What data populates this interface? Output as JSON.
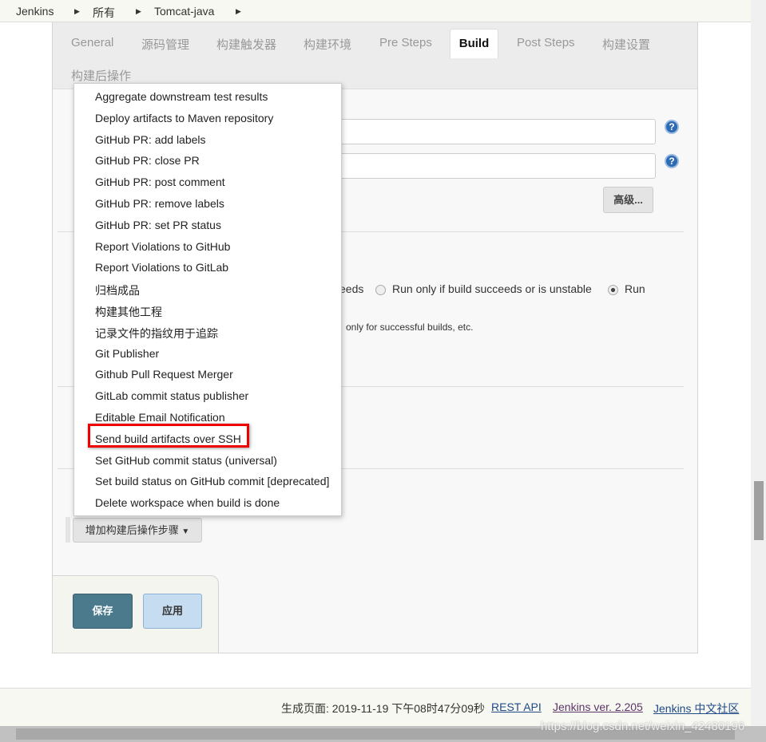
{
  "breadcrumb": [
    "Jenkins",
    "所有",
    "Tomcat-java"
  ],
  "tabs": [
    "General",
    "源码管理",
    "构建触发器",
    "构建环境",
    "Pre Steps",
    "Build",
    "Post Steps",
    "构建设置",
    "构建后操作"
  ],
  "active_tab": "Build",
  "advanced_button": "高级...",
  "radio_fragment": "eeds",
  "radio_option_unstable": "Run only if build succeeds or is unstable",
  "radio_option_run": "Run",
  "help_fragment": "only for successful builds, etc.",
  "menu_items": [
    "Aggregate downstream test results",
    "Deploy artifacts to Maven repository",
    "GitHub PR: add labels",
    "GitHub PR: close PR",
    "GitHub PR: post comment",
    "GitHub PR: remove labels",
    "GitHub PR: set PR status",
    "Report Violations to GitHub",
    "Report Violations to GitLab",
    "归档成品",
    "构建其他工程",
    "记录文件的指纹用于追踪",
    "Git Publisher",
    "Github Pull Request Merger",
    "GitLab commit status publisher",
    "Editable Email Notification",
    "Send build artifacts over SSH",
    "Set GitHub commit status (universal)",
    "Set build status on GitHub commit [deprecated]",
    "Delete workspace when build is done"
  ],
  "highlighted_item": "Send build artifacts over SSH",
  "add_post_build_button": "增加构建后操作步骤",
  "save_button": "保存",
  "apply_button": "应用",
  "footer": {
    "generated": "生成页面: 2019-11-19 下午08时47分09秒",
    "rest_api": "REST API",
    "version": "Jenkins ver. 2.205",
    "community": "Jenkins 中文社区"
  },
  "watermark": "https://blog.csdn.net/weixin_42480196",
  "colors": {
    "save": "#4a7a8c",
    "apply": "#c6dcf0",
    "highlight": "#e00000",
    "link": "#204a87"
  }
}
